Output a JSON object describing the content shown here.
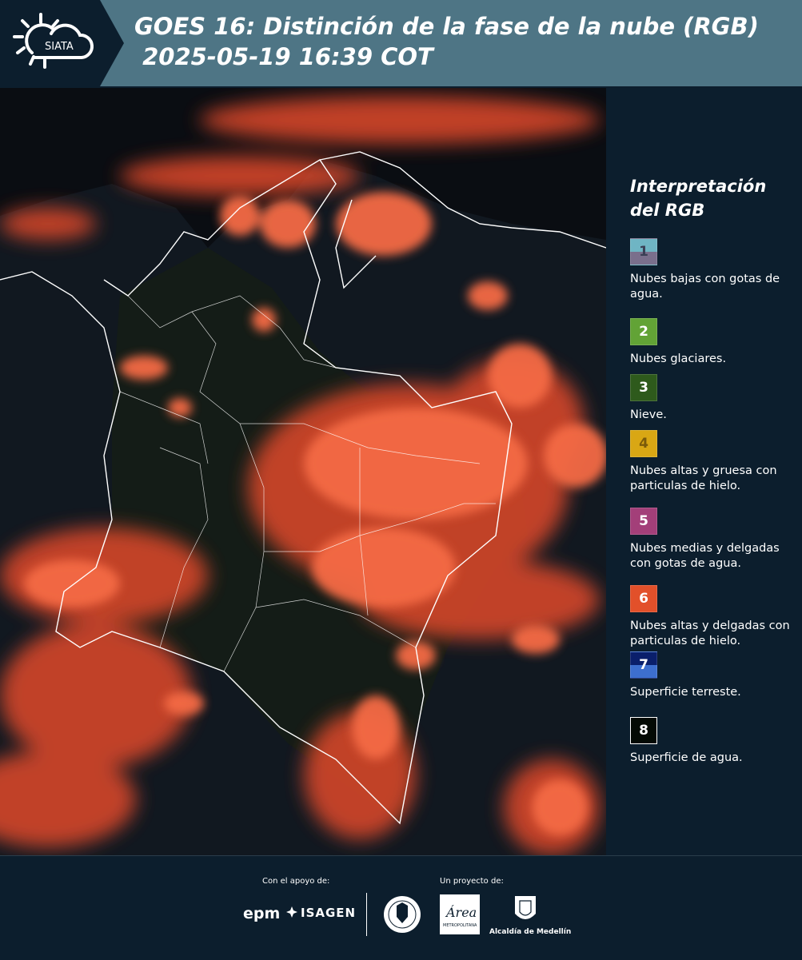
{
  "header": {
    "logo_text": "SIATA",
    "title_line1": "GOES 16: Distinción de la fase de la nube (RGB)",
    "title_line2": " 2025-05-19 16:39 COT"
  },
  "legend": {
    "title_line1": "Interpretación",
    "title_line2": "del RGB",
    "items": [
      {
        "number": "1",
        "label": "Nubes bajas con gotas de agua.",
        "color_top": "#6fb5c4",
        "color_bottom": "#7a6f8c"
      },
      {
        "number": "2",
        "label": "Nubes glaciares.",
        "color_top": "#62a336",
        "color_bottom": "#62a336"
      },
      {
        "number": "3",
        "label": "Nieve.",
        "color_top": "#2e5a1c",
        "color_bottom": "#2e5a1c"
      },
      {
        "number": "4",
        "label": "Nubes altas y gruesa con particulas de hielo.",
        "color_top": "#d9a714",
        "color_bottom": "#d9a714"
      },
      {
        "number": "5",
        "label": "Nubes medias y delgadas con gotas de agua.",
        "color_top": "#a33f79",
        "color_bottom": "#a33f79"
      },
      {
        "number": "6",
        "label": "Nubes altas y delgadas con particulas de hielo.",
        "color_top": "#e2502a",
        "color_bottom": "#e2502a"
      },
      {
        "number": "7",
        "label": "Superficie terreste.",
        "color_top": "#0a1f6b",
        "color_bottom": "#3d6fcf"
      },
      {
        "number": "8",
        "label": "Superficie de agua.",
        "color_top": "#040a04",
        "color_bottom": "#040a04"
      }
    ]
  },
  "footer": {
    "support_label": "Con el apoyo de:",
    "project_label": "Un proyecto de:",
    "sponsor1": "epm",
    "sponsor2": "ISAGEN",
    "partner_area_text": "Área",
    "partner_area_sub": "METROPOLITANA",
    "partner_alcaldia": "Alcaldía de Medellín"
  },
  "colors": {
    "header_bg": "#4e7585",
    "panel_bg": "#0c1e2d",
    "cloud_orange": "#f0583a",
    "ocean": "#0a0d12"
  }
}
